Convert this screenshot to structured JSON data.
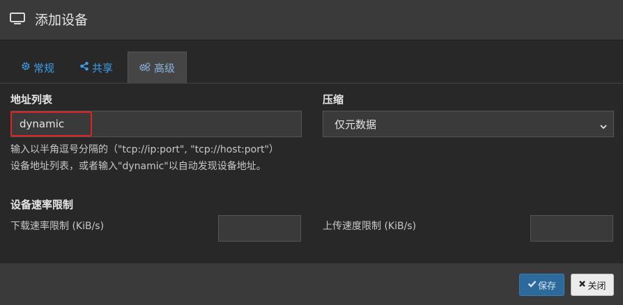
{
  "dialog": {
    "title": "添加设备",
    "icon": "monitor-icon"
  },
  "tabs": [
    {
      "label": "常规",
      "icon": "gear-icon",
      "active": false
    },
    {
      "label": "共享",
      "icon": "share-icon",
      "active": false
    },
    {
      "label": "高级",
      "icon": "gears-icon",
      "active": true
    }
  ],
  "advanced": {
    "address_list": {
      "label": "地址列表",
      "value": "dynamic",
      "help_line1": "输入以半角逗号分隔的（\"tcp://ip:port\", \"tcp://host:port\"）",
      "help_line2": "设备地址列表，或者输入\"dynamic\"以自动发现设备地址。"
    },
    "compression": {
      "label": "压缩",
      "selected": "仅元数据"
    },
    "rate_limit": {
      "label": "设备速率限制",
      "download_label": "下载速率限制 (KiB/s)",
      "download_value": "",
      "upload_label": "上传速度限制 (KiB/s)",
      "upload_value": ""
    }
  },
  "footer": {
    "save_label": "保存",
    "close_label": "关闭"
  },
  "colors": {
    "accent": "#3c9ee8",
    "highlight": "#e02424",
    "save_button": "#2d6a9c"
  }
}
